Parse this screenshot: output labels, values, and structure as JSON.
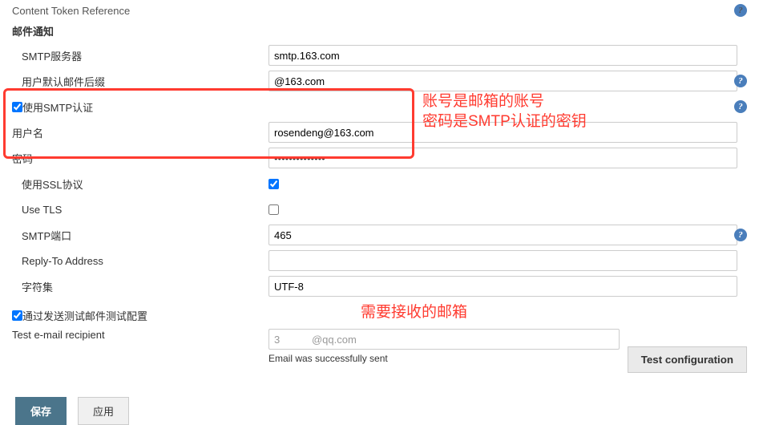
{
  "topLink": "Content Token Reference",
  "sectionTitle": "邮件通知",
  "labels": {
    "smtpServer": "SMTP服务器",
    "defaultSuffix": "用户默认邮件后缀",
    "useSmtpAuth": "使用SMTP认证",
    "username": "用户名",
    "password": "密码",
    "useSsl": "使用SSL协议",
    "useTls": "Use TLS",
    "smtpPort": "SMTP端口",
    "replyTo": "Reply-To Address",
    "charset": "字符集",
    "testBySend": "通过发送测试邮件测试配置",
    "testRecipient": "Test e-mail recipient"
  },
  "values": {
    "smtpServer": "smtp.163.com",
    "defaultSuffix": "@163.com",
    "useSmtpAuth": true,
    "username": "rosendeng@163.com",
    "password": "••••••••••••••",
    "useSsl": true,
    "useTls": false,
    "smtpPort": "465",
    "replyTo": "",
    "charset": "UTF-8",
    "testBySend": true,
    "testRecipient": "3           @qq.com"
  },
  "status": "Email was successfully sent",
  "buttons": {
    "save": "保存",
    "apply": "应用",
    "testConfig": "Test configuration"
  },
  "annotations": {
    "auth": "账号是邮箱的账号\n密码是SMTP认证的密钥",
    "recipient": "需要接收的邮箱"
  },
  "helpGlyph": "?"
}
